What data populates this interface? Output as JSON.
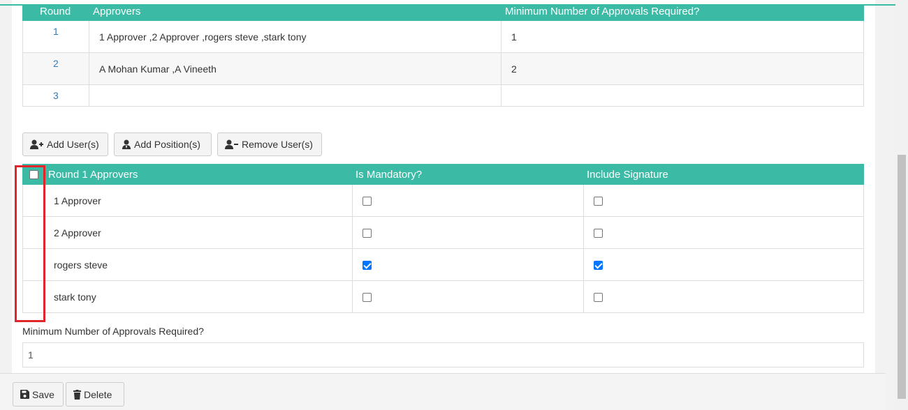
{
  "rounds_table": {
    "headers": [
      "Round",
      "Approvers",
      "Minimum Number of Approvals Required?"
    ],
    "rows": [
      {
        "round": "1",
        "approvers": "1 Approver ,2 Approver ,rogers steve ,stark tony",
        "min": "1"
      },
      {
        "round": "2",
        "approvers": "A Mohan Kumar ,A Vineeth",
        "min": "2"
      },
      {
        "round": "3",
        "approvers": "",
        "min": ""
      }
    ]
  },
  "toolbar": {
    "add_users": "Add User(s)",
    "add_positions": "Add Position(s)",
    "remove_users": "Remove User(s)"
  },
  "approvers_table": {
    "headers": [
      "Round 1 Approvers",
      "Is Mandatory?",
      "Include Signature"
    ],
    "rows": [
      {
        "name": "1 Approver",
        "mandatory": false,
        "signature": false
      },
      {
        "name": "2 Approver",
        "mandatory": false,
        "signature": false
      },
      {
        "name": "rogers steve",
        "mandatory": true,
        "signature": true
      },
      {
        "name": "stark tony",
        "mandatory": false,
        "signature": false
      }
    ]
  },
  "min_approvals": {
    "label": "Minimum Number of Approvals Required?",
    "value": "1"
  },
  "footer": {
    "save": "Save",
    "delete": "Delete"
  },
  "colors": {
    "accent": "#3bbaa6",
    "link": "#337ab7",
    "highlight": "#e0262b"
  }
}
